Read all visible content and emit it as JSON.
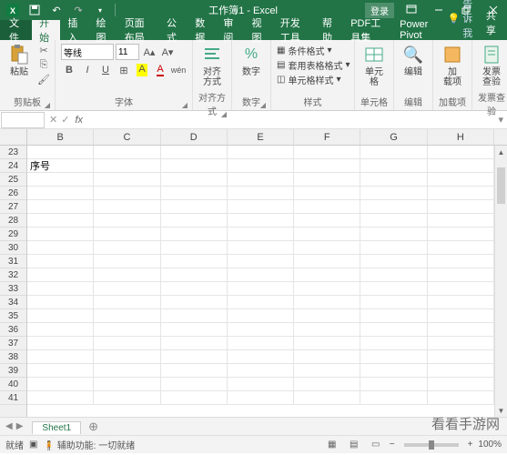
{
  "title": "工作簿1 - Excel",
  "login": "登录",
  "qat": {
    "save": "💾",
    "undo": "↶",
    "redo": "↷"
  },
  "tabs": {
    "file": "文件",
    "items": [
      "开始",
      "插入",
      "绘图",
      "页面布局",
      "公式",
      "数据",
      "审阅",
      "视图",
      "开发工具",
      "帮助",
      "PDF工具集",
      "Power Pivot"
    ],
    "active": 0,
    "tellme": "告诉我",
    "share": "共享"
  },
  "ribbon": {
    "clipboard": {
      "paste": "粘贴",
      "label": "剪贴板"
    },
    "font": {
      "name": "等线",
      "size": "11",
      "label": "字体"
    },
    "align": {
      "btn": "对齐方式",
      "label": "对齐方式"
    },
    "number": {
      "btn": "数字",
      "label": "数字"
    },
    "styles": {
      "cond": "条件格式",
      "table": "套用表格格式",
      "cell": "单元格样式",
      "label": "样式"
    },
    "cells": {
      "btn": "单元格",
      "label": "单元格"
    },
    "editing": {
      "btn": "编辑",
      "label": "编辑"
    },
    "addins": {
      "btn1": "加\n载项",
      "label": "加载项"
    },
    "fapiao": {
      "btn": "发票\n查验",
      "label": "发票查验"
    }
  },
  "namebox": "",
  "grid": {
    "cols": [
      "B",
      "C",
      "D",
      "E",
      "F",
      "G",
      "H"
    ],
    "rowStart": 23,
    "rowEnd": 41,
    "data": {
      "24_B": "序号"
    }
  },
  "sheetbar": {
    "tab": "Sheet1"
  },
  "status": {
    "ready": "就绪",
    "acc": "辅助功能: 一切就绪",
    "zoom": "100%"
  },
  "watermark": "看看手游网"
}
